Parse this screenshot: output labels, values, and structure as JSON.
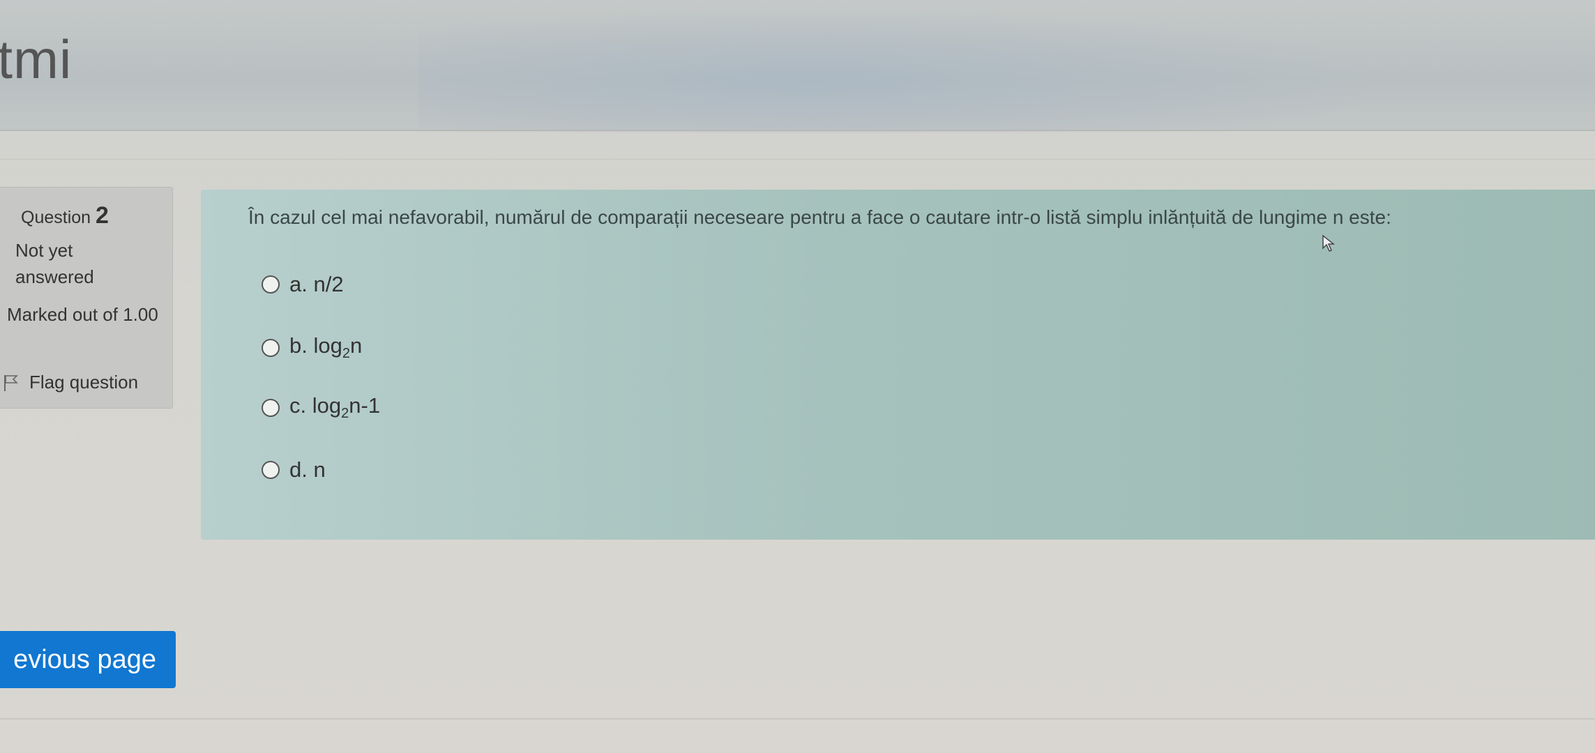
{
  "header": {
    "title": "itmi"
  },
  "question_info": {
    "label": "Question",
    "number": "2",
    "status": "Not yet answered",
    "marks": "Marked out of 1.00",
    "flag_label": "Flag question"
  },
  "question": {
    "text": "În cazul cel mai nefavorabil, numărul de comparații neceseare pentru a face o cautare intr-o listă simplu inlănțuită de lungime n este:",
    "options": [
      {
        "prefix": "a.",
        "text": "n/2"
      },
      {
        "prefix": "b.",
        "text_before": "log",
        "sub": "2",
        "text_after": "n"
      },
      {
        "prefix": "c.",
        "text_before": "log",
        "sub": "2",
        "text_after": "n-1"
      },
      {
        "prefix": "d.",
        "text": "n"
      }
    ]
  },
  "navigation": {
    "previous_label": "evious page"
  },
  "colors": {
    "accent": "#1177d1",
    "question_bg": "#a6c2bd",
    "info_bg": "#c7c8c5"
  }
}
